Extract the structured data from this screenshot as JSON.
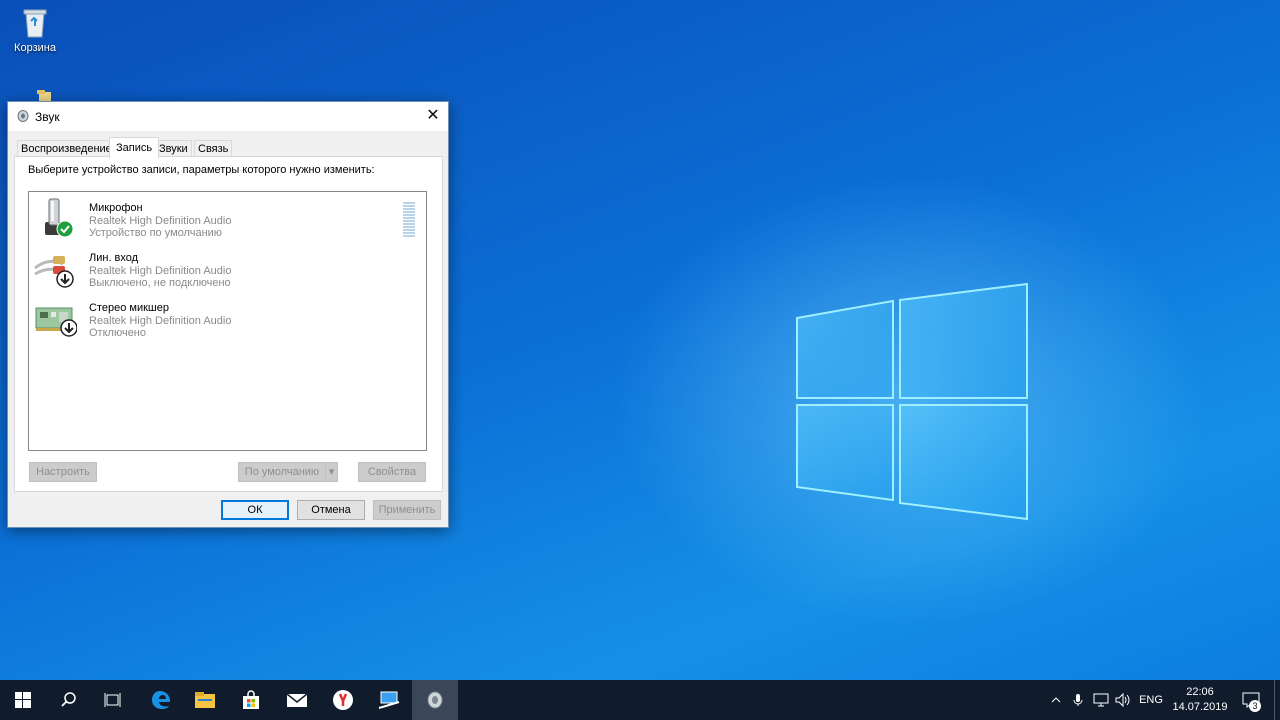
{
  "desktop": {
    "icons": [
      {
        "label": "Корзина",
        "icon": "recycle-bin-icon"
      }
    ]
  },
  "dialog": {
    "title": "Звук",
    "close_glyph": "✕",
    "tabs": [
      {
        "label": "Воспроизведение",
        "active": false
      },
      {
        "label": "Запись",
        "active": true
      },
      {
        "label": "Звуки",
        "active": false
      },
      {
        "label": "Связь",
        "active": false
      }
    ],
    "description": "Выберите устройство записи, параметры которого нужно изменить:",
    "devices": [
      {
        "name": "Микрофон",
        "driver": "Realtek High Definition Audio",
        "status": "Устройство по умолчанию",
        "icon": "microphone-icon",
        "badge": "default-check-icon"
      },
      {
        "name": "Лин. вход",
        "driver": "Realtek High Definition Audio",
        "status": "Выключено, не подключено",
        "icon": "line-in-icon",
        "badge": "disabled-arrow-icon"
      },
      {
        "name": "Стерео микшер",
        "driver": "Realtek High Definition Audio",
        "status": "Отключено",
        "icon": "sound-card-icon",
        "badge": "disabled-arrow-icon"
      }
    ],
    "buttons": {
      "configure": "Настроить",
      "default": "По умолчанию",
      "properties": "Свойства",
      "ok": "ОК",
      "cancel": "Отмена",
      "apply": "Применить"
    }
  },
  "taskbar": {
    "apps": [
      "start-icon",
      "search-icon",
      "task-view-icon",
      "edge-icon",
      "file-explorer-icon",
      "store-icon",
      "mail-icon",
      "yandex-browser-icon",
      "remote-desktop-icon",
      "sound-settings-icon"
    ],
    "tray": {
      "language": "ENG",
      "time": "22:06",
      "date": "14.07.2019",
      "notifications": "3"
    }
  },
  "colors": {
    "accent": "#0078d7",
    "taskbar": "#101c2c",
    "check_green": "#1e9e3c"
  }
}
